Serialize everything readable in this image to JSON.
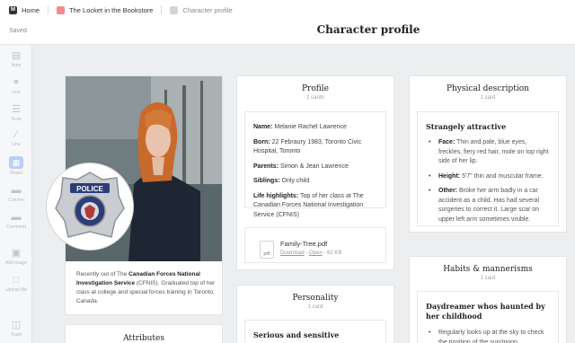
{
  "breadcrumb": {
    "home": "Home",
    "board": "The Locket in the Bookstore",
    "page": "Character profile",
    "board_color": "#f28b8b",
    "page_color": "#d3d5d7"
  },
  "header": {
    "saved": "Saved",
    "title": "Character profile"
  },
  "toolbar": [
    {
      "label": "Note",
      "icon": "note-icon"
    },
    {
      "label": "Link",
      "icon": "link-icon"
    },
    {
      "label": "To-do",
      "icon": "todo-icon"
    },
    {
      "label": "Line",
      "icon": "line-icon"
    },
    {
      "label": "Board",
      "icon": "board-icon"
    },
    {
      "label": "Column",
      "icon": "column-icon"
    },
    {
      "label": "Comment",
      "icon": "comment-icon"
    },
    {
      "label": "Add image",
      "icon": "image-icon"
    },
    {
      "label": "Upload file",
      "icon": "upload-icon"
    },
    {
      "label": "Trash",
      "icon": "trash-icon"
    }
  ],
  "image_card": {
    "badge_text": "POLICE",
    "caption_pre": "Recently out of The ",
    "caption_bold": "Canadian Forces National Investigation Service",
    "caption_post": " (CFNIS). Graduated top of her class at college and special forces training in Toronto, Canada."
  },
  "attributes": {
    "title": "Attributes"
  },
  "profile": {
    "title": "Profile",
    "count": "2 cards",
    "fields": [
      {
        "label": "Name:",
        "value": "Melanie Rachel Lawrence"
      },
      {
        "label": "Born:",
        "value": "22 Febraury 1983, Toronto Civic Hospital, Toronto"
      },
      {
        "label": "Parents:",
        "value": "Simon & Jean Lawrence"
      },
      {
        "label": "Siblings:",
        "value": "Only child"
      },
      {
        "label": "Life highlights:",
        "value": "Top of her class at The Canadian Forces National Investigation Service (CFNIS)"
      }
    ],
    "file": {
      "ext": "pdf",
      "name": "Family-Tree.pdf",
      "download": "Download",
      "sep": " - ",
      "open": "Open",
      "size": " - 62 KB"
    }
  },
  "personality": {
    "title": "Personality",
    "count": "1 card",
    "heading": "Serious and sensitive"
  },
  "physical": {
    "title": "Physical description",
    "count": "1 card",
    "heading": "Strangely attractive",
    "items": [
      {
        "label": "Face:",
        "value": "Thin and pale, blue eyes, freckles, fiery red hair, mole on top right side of her lip."
      },
      {
        "label": "Height:",
        "value": "5'7\" thin and muscular frame."
      },
      {
        "label": "Other:",
        "value": "Broke her arm badly in a car accident as a child. Has had several surgeries to correct it. Large scar on upper left arm sometimes visible."
      }
    ]
  },
  "habits": {
    "title": "Habits & mannerisms",
    "count": "1 card",
    "heading": "Daydreamer whos haunted by her childhood",
    "items": [
      {
        "value": "Regularly looks up at the sky to check the position of the sun/moon"
      }
    ]
  }
}
